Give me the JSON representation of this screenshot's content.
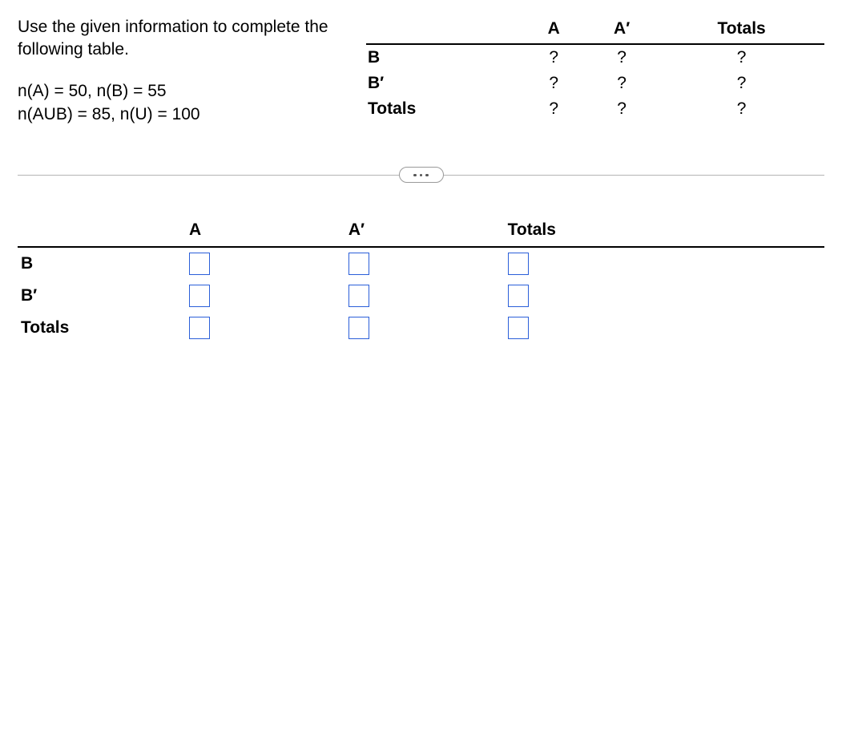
{
  "prompt": {
    "instruction": "Use the given information to complete the following table.",
    "given_line1": "n(A) = 50, n(B) = 55",
    "given_line2": "n(AUB) = 85, n(U) = 100"
  },
  "mini_table": {
    "col_headers": [
      "",
      "A",
      "A′",
      "Totals"
    ],
    "rows": [
      {
        "label": "B",
        "cells": [
          "?",
          "?",
          "?"
        ]
      },
      {
        "label": "B′",
        "cells": [
          "?",
          "?",
          "?"
        ]
      },
      {
        "label": "Totals",
        "cells": [
          "?",
          "?",
          "?"
        ]
      }
    ]
  },
  "answer_table": {
    "col_headers": [
      "",
      "A",
      "A′",
      "Totals"
    ],
    "rows": [
      {
        "label": "B",
        "inputs": [
          "",
          "",
          ""
        ]
      },
      {
        "label": "B′",
        "inputs": [
          "",
          "",
          ""
        ]
      },
      {
        "label": "Totals",
        "inputs": [
          "",
          "",
          ""
        ]
      }
    ]
  }
}
